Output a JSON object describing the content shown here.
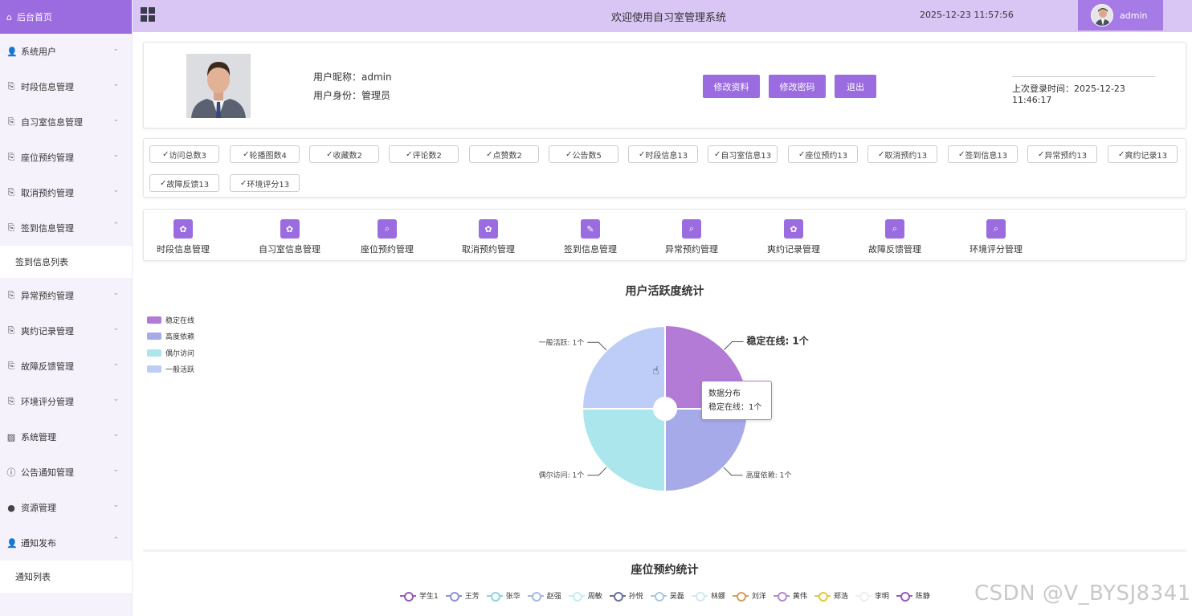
{
  "sidebar": {
    "home": "后台首页",
    "items": [
      {
        "label": "系统用户",
        "icon": "user-icon",
        "chev": "⌄"
      },
      {
        "label": "时段信息管理",
        "icon": "doc-icon",
        "chev": "⌄"
      },
      {
        "label": "自习室信息管理",
        "icon": "doc-icon",
        "chev": "⌄"
      },
      {
        "label": "座位预约管理",
        "icon": "doc-icon",
        "chev": "⌄"
      },
      {
        "label": "取消预约管理",
        "icon": "doc-icon",
        "chev": "⌄"
      },
      {
        "label": "签到信息管理",
        "icon": "doc-icon",
        "chev": "⌃"
      },
      {
        "label": "异常预约管理",
        "icon": "doc-icon",
        "chev": "⌄"
      },
      {
        "label": "爽约记录管理",
        "icon": "doc-icon",
        "chev": "⌄"
      },
      {
        "label": "故障反馈管理",
        "icon": "doc-icon",
        "chev": "⌄"
      },
      {
        "label": "环境评分管理",
        "icon": "doc-icon",
        "chev": "⌄"
      },
      {
        "label": "系统管理",
        "icon": "image-icon",
        "chev": "⌄"
      },
      {
        "label": "公告通知管理",
        "icon": "info-icon",
        "chev": "⌄"
      },
      {
        "label": "资源管理",
        "icon": "bulb-icon",
        "chev": "⌄"
      },
      {
        "label": "通知发布",
        "icon": "user-icon",
        "chev": "⌃"
      }
    ],
    "sub_checkin": "签到信息列表",
    "sub_notice": "通知列表"
  },
  "topbar": {
    "title": "欢迎使用自习室管理系统",
    "time": "2025-12-23 11:57:56",
    "user": "admin"
  },
  "profile": {
    "nick": "用户昵称：admin",
    "role": "用户身份：管理员",
    "btn_edit": "修改资料",
    "btn_pwd": "修改密码",
    "btn_logout": "退出",
    "last_login": "上次登录时间：2025-12-23 11:46:17"
  },
  "stats": [
    "访问总数3",
    "轮播图数4",
    "收藏数2",
    "评论数2",
    "点赞数2",
    "公告数5",
    "时段信息13",
    "自习室信息13",
    "座位预约13",
    "取消预约13",
    "签到信息13",
    "异常预约13",
    "爽约记录13",
    "故障反馈13",
    "环境评分13"
  ],
  "quicknav": [
    {
      "label": "时段信息管理",
      "icon": "gear-icon"
    },
    {
      "label": "自习室信息管理",
      "icon": "gear-icon"
    },
    {
      "label": "座位预约管理",
      "icon": "search-icon"
    },
    {
      "label": "取消预约管理",
      "icon": "gear-icon"
    },
    {
      "label": "签到信息管理",
      "icon": "edit-icon"
    },
    {
      "label": "异常预约管理",
      "icon": "search-icon"
    },
    {
      "label": "爽约记录管理",
      "icon": "gear-icon"
    },
    {
      "label": "故障反馈管理",
      "icon": "search-icon"
    },
    {
      "label": "环境评分管理",
      "icon": "search-icon"
    }
  ],
  "chart_data": [
    {
      "type": "pie",
      "title": "用户活跃度统计",
      "categories": [
        "稳定在线",
        "高度依赖",
        "偶尔访问",
        "一般活跃"
      ],
      "values": [
        1,
        1,
        1,
        1
      ],
      "colors": [
        "#b37bd6",
        "#a7aae8",
        "#abe6ec",
        "#bdcdf7"
      ],
      "slice_labels": [
        "稳定在线: 1个",
        "高度依赖: 1个",
        "偶尔访问: 1个",
        "一般活跃: 1个"
      ],
      "legend_position": "top-left",
      "tooltip": {
        "title": "数据分布",
        "text": "稳定在线：1个"
      }
    },
    {
      "type": "line",
      "title": "座位预约统计",
      "series": [
        {
          "name": "学生1",
          "color": "#9b59b6"
        },
        {
          "name": "王芳",
          "color": "#8e92d8"
        },
        {
          "name": "张华",
          "color": "#8fd3dc"
        },
        {
          "name": "赵强",
          "color": "#a6b8e8"
        },
        {
          "name": "周敏",
          "color": "#c4eef0"
        },
        {
          "name": "孙悦",
          "color": "#6a6f9a"
        },
        {
          "name": "吴磊",
          "color": "#a8c9e0"
        },
        {
          "name": "林娜",
          "color": "#cfe9f0"
        },
        {
          "name": "刘洋",
          "color": "#d6a15a"
        },
        {
          "name": "黄伟",
          "color": "#b58ad0"
        },
        {
          "name": "郑浩",
          "color": "#e2c93c"
        },
        {
          "name": "李明",
          "color": "#eeeeee"
        },
        {
          "name": "陈静",
          "color": "#9b59b6"
        }
      ],
      "legend_position": "top"
    }
  ],
  "watermark": "CSDN @V_BYSJ8341"
}
